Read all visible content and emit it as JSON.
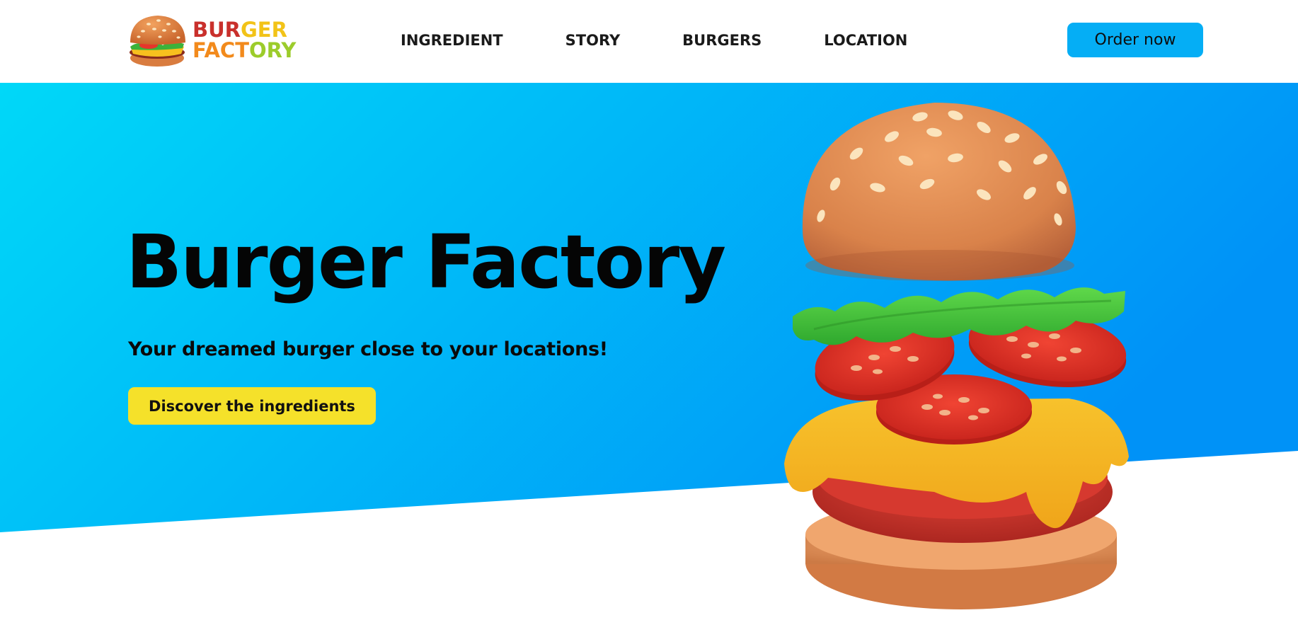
{
  "header": {
    "logo": {
      "line1_a": "BUR",
      "line1_b": "GER",
      "line2_a": "FACT",
      "line2_b": "ORY",
      "icon": "burger-icon"
    },
    "nav": [
      {
        "label": "INGREDIENT"
      },
      {
        "label": "STORY"
      },
      {
        "label": "BURGERS"
      },
      {
        "label": "LOCATION"
      }
    ],
    "order_button": "Order now"
  },
  "hero": {
    "title": "Burger Factory",
    "subtitle": "Your dreamed burger close to your locations!",
    "cta": "Discover the ingredients",
    "illustration": "exploded-burger-illustration"
  },
  "colors": {
    "hero_gradient_start": "#00d8f8",
    "hero_gradient_end": "#0092f7",
    "order_button": "#05aef5",
    "cta_button": "#f5e12a",
    "logo_red": "#c9302c",
    "logo_yellow": "#f2c318",
    "logo_orange": "#f28a1c",
    "logo_green": "#9ccc2b"
  }
}
